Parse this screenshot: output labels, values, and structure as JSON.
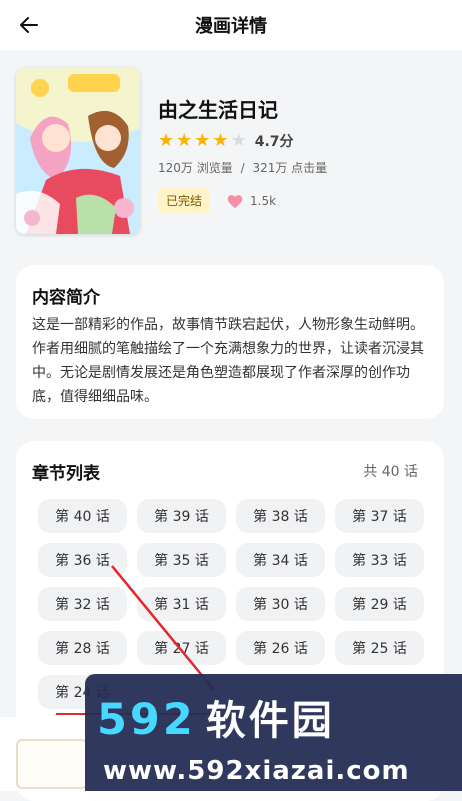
{
  "header": {
    "title": "漫画详情",
    "back_icon": "arrow-left-icon"
  },
  "comic": {
    "title": "由之生活日记",
    "rating": {
      "stars_filled": 4,
      "stars_total": 5,
      "score": "4.7分"
    },
    "views": "120万 浏览量",
    "clicks": "321万 点击量",
    "separator": "/",
    "status": "已完结",
    "likes": "1.5k",
    "accent_color": "#f7b500",
    "heart_color": "#f48fa8"
  },
  "intro": {
    "heading": "内容简介",
    "text": "这是一部精彩的作品，故事情节跌宕起伏，人物形象生动鲜明。作者用细腻的笔触描绘了一个充满想象力的世界，让读者沉浸其中。无论是剧情发展还是角色塑造都展现了作者深厚的创作功底，值得细细品味。"
  },
  "chapters": {
    "heading": "章节列表",
    "count": "共 40 话",
    "items": [
      "第 40 话",
      "第 39 话",
      "第 38 话",
      "第 37 话",
      "第 36 话",
      "第 35 话",
      "第 34 话",
      "第 33 话",
      "第 32 话",
      "第 31 话",
      "第 30 话",
      "第 29 话",
      "第 28 话",
      "第 27 话",
      "第 26 话",
      "第 25 话",
      "第 24 话"
    ]
  },
  "watermark": {
    "main": "592",
    "cn": "软件园",
    "url": "www.592xiazai.com"
  }
}
